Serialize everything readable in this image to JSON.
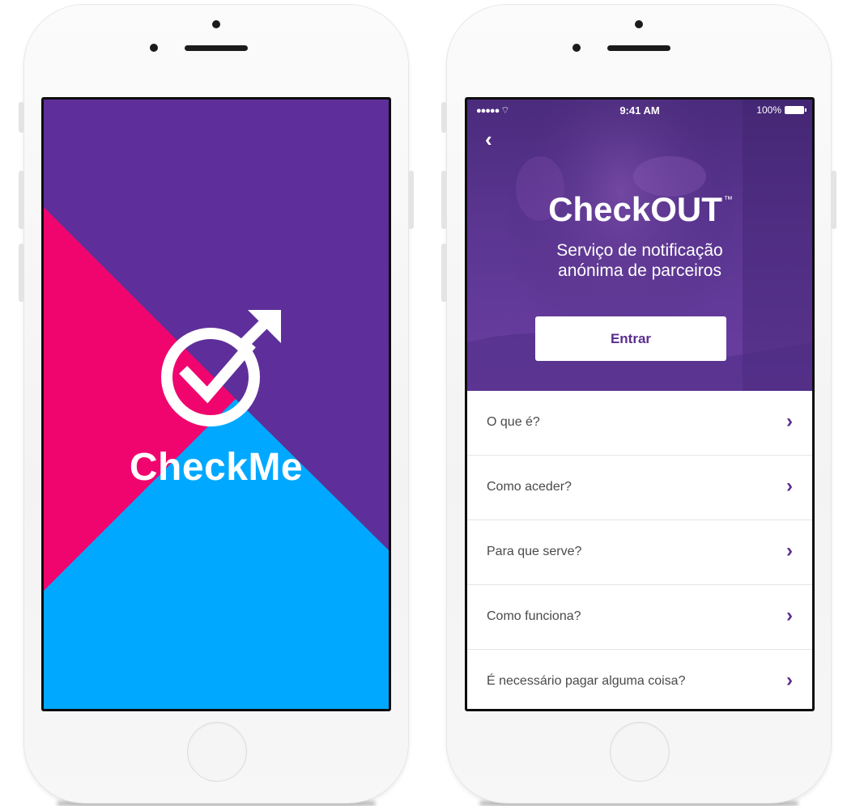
{
  "colors": {
    "purple": "#5e2f9a",
    "pink": "#f0056e",
    "blue": "#00a8ff",
    "accent": "#5b2d8f"
  },
  "splash": {
    "brand": "CheckMe",
    "logo_icon": "checkmark-male-symbol-icon"
  },
  "detail": {
    "status": {
      "signal": "●●●●● ",
      "time": "9:41 AM",
      "battery": "100%"
    },
    "title": "CheckOUT",
    "trademark": "™",
    "subtitle_line1": "Serviço de notificação",
    "subtitle_line2": "anónima de parceiros",
    "enter_label": "Entrar",
    "faq": [
      {
        "label": "O que é?"
      },
      {
        "label": "Como aceder?"
      },
      {
        "label": "Para que serve?"
      },
      {
        "label": "Como funciona?"
      },
      {
        "label": "É necessário pagar alguma coisa?"
      }
    ]
  }
}
